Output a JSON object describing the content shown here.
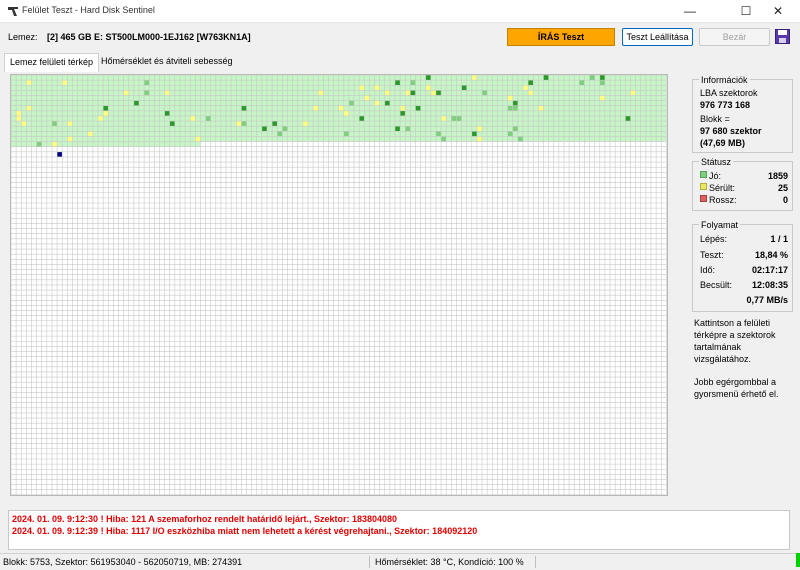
{
  "window": {
    "title": "Felület Teszt - Hard Disk Sentinel",
    "minimize_glyph": "—",
    "maximize_glyph": "☐",
    "close_glyph": "✕"
  },
  "toolbar": {
    "disk_label": "Lemez:",
    "disk_name": "[2] 465 GB E: ST500LM000-1EJ162 [W763KN1A]",
    "status_pill": "ÍRÁS Teszt",
    "stop_button": "Teszt Leállítása",
    "close_button": "Bezár",
    "save_icon": "save-icon"
  },
  "tabs": {
    "map": "Lemez felületi térkép",
    "temp": "Hőmérséklet és átviteli sebesség"
  },
  "map": {
    "tested_fraction": 0.1884,
    "colors": {
      "tested": "#c6f5c6",
      "untested": "#ffffff",
      "grid": "#c8c8c8",
      "tested_grid": "#a8d8a8",
      "damaged": "#ffff80",
      "dark_green": "#2a9a2a",
      "mid_green": "#7ed07e",
      "current": "#000080"
    }
  },
  "info": {
    "title": "Információk",
    "lba_label": "LBA szektorok",
    "lba_value": "976 773 168",
    "block_label": "Blokk =",
    "block_sectors": "97 680 szektor",
    "block_mb": "(47,69 MB)"
  },
  "status": {
    "title": "Státusz",
    "good_label": "Jó:",
    "good_value": "1859",
    "good_color": "#7ed07e",
    "damaged_label": "Sérült:",
    "damaged_value": "25",
    "damaged_color": "#e8e860",
    "bad_label": "Rossz:",
    "bad_value": "0",
    "bad_color": "#e06060"
  },
  "progress": {
    "title": "Folyamat",
    "step_label": "Lépés:",
    "step_value": "1 / 1",
    "test_label": "Teszt:",
    "test_value": "18,84 %",
    "time_label": "Idő:",
    "time_value": "02:17:17",
    "estimate_label": "Becsült:",
    "estimate_value": "12:08:35",
    "speed_value": "0,77 MB/s"
  },
  "help": {
    "line1": "Kattintson a felületi térképre a szektorok tartalmának vizsgálatához.",
    "line2": "Jobb egérgombbal a gyorsmenü érhető el."
  },
  "log": [
    "2024. 01. 09.  9:12:30 ! Hiba: 121 A szemaforhoz rendelt határidő lejárt., Szektor: 183804080",
    "2024. 01. 09.  9:12:39 ! Hiba: 1117 I/O eszközhiba miatt nem lehetett a kérést végrehajtani., Szektor: 184092120"
  ],
  "statusbar": {
    "position": "Blokk: 5753, Szektor: 561953040 - 562050719, MB: 274391",
    "temperature": "Hőmérséklet: 38 °C,  Kondíció: 100 %"
  }
}
